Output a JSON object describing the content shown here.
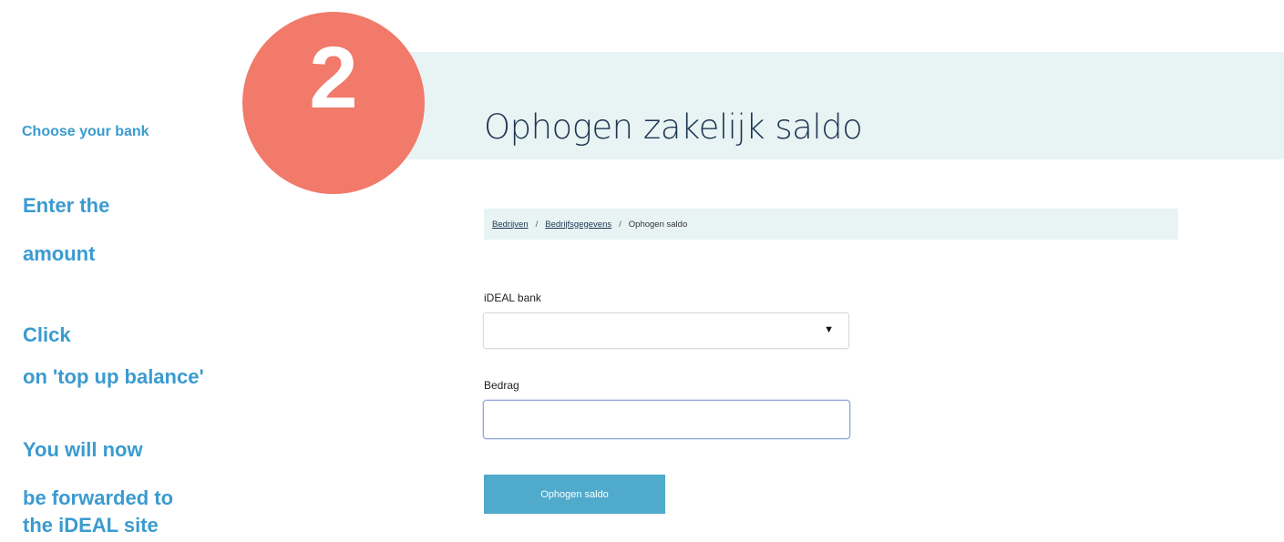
{
  "step": {
    "number": "2",
    "circle_color": "#f17a6a"
  },
  "instructions": {
    "line1": "Choose your bank",
    "line2": "Enter the",
    "line3": "amount",
    "line4": "Click",
    "line5": "on 'top up balance'",
    "line6": "You will now",
    "line7": "be forwarded to",
    "line8": "the iDEAL site",
    "color": "#3a9bd0"
  },
  "header": {
    "title": "Ophogen zakelijk saldo"
  },
  "breadcrumb": {
    "items": [
      "Bedrijven",
      "Bedrijfsgegevens",
      "Ophogen saldo"
    ],
    "separator": "/"
  },
  "form": {
    "bank_label": "iDEAL bank",
    "bank_value": "",
    "amount_label": "Bedrag",
    "amount_value": "",
    "submit_label": "Ophogen saldo"
  },
  "colors": {
    "accent": "#4faacb",
    "header_band": "#e8f4f4",
    "title": "#1e3552"
  }
}
